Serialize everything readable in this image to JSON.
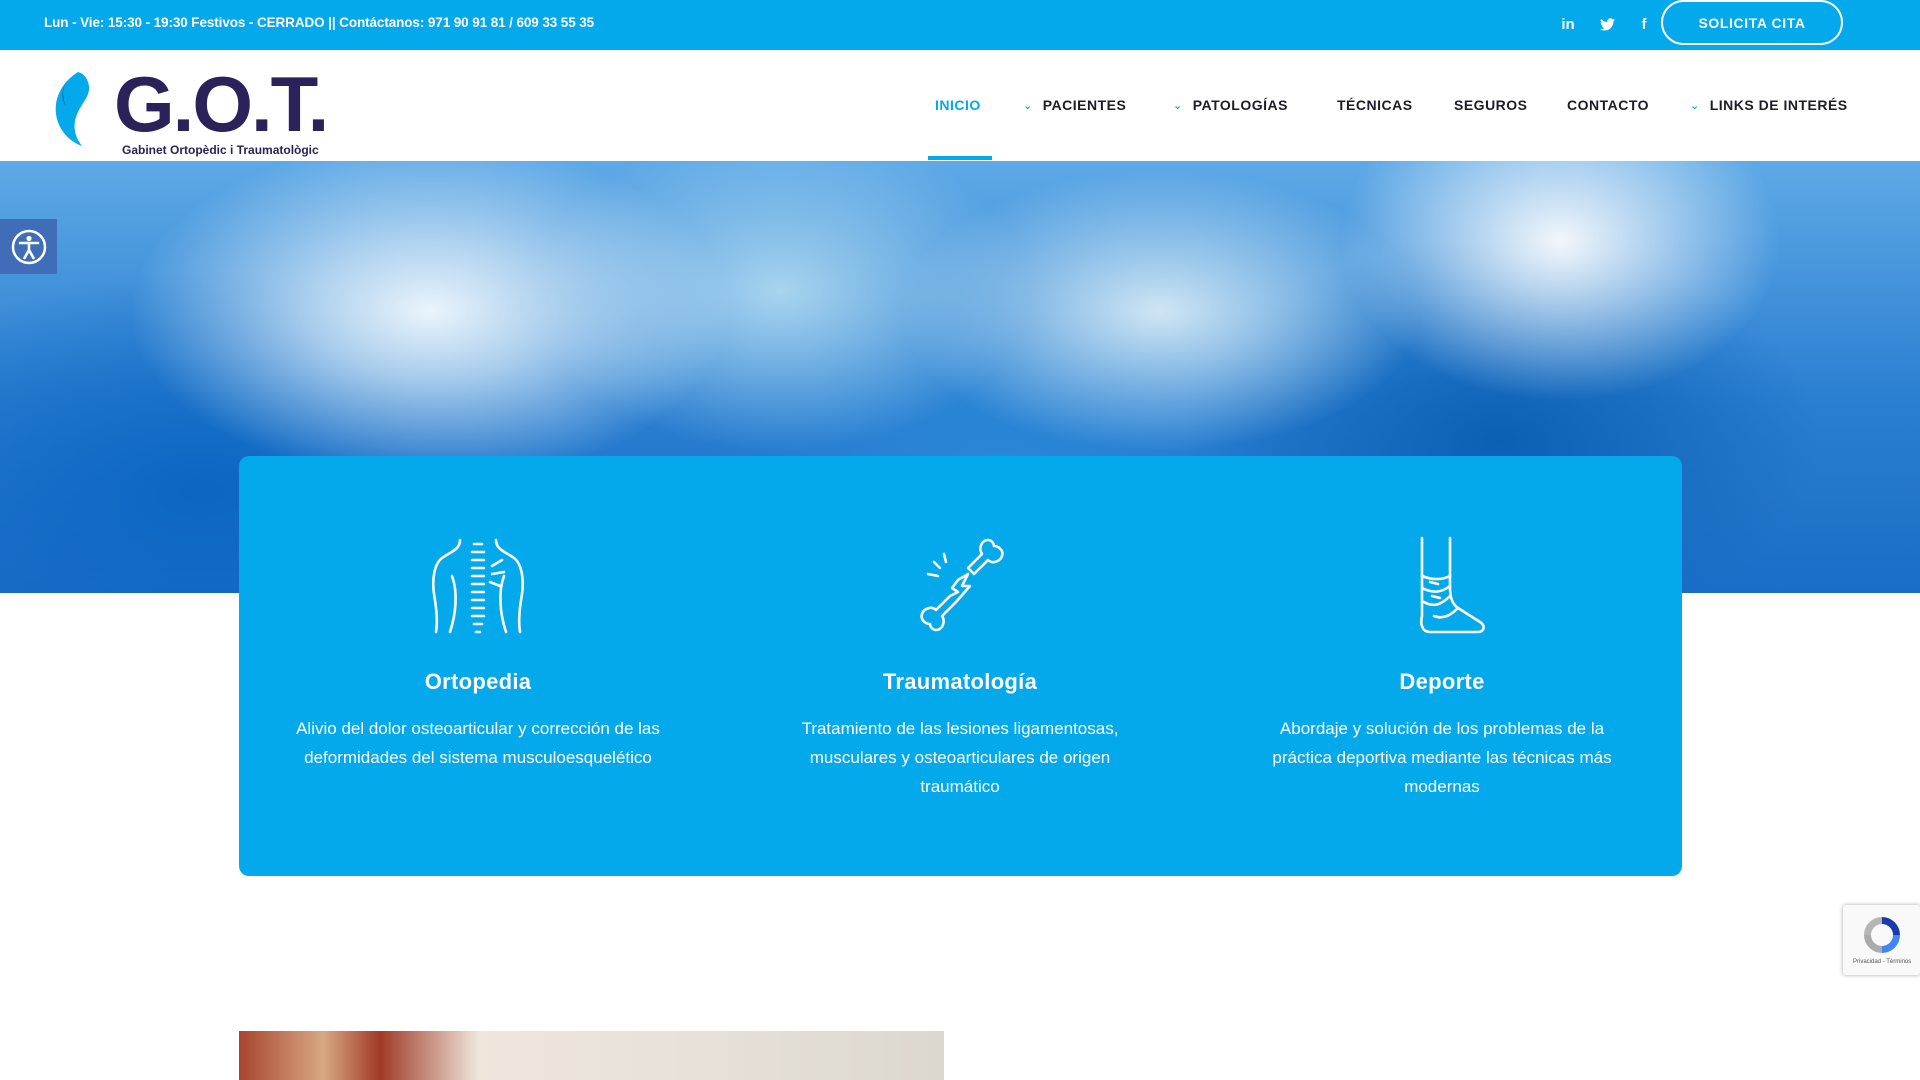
{
  "topbar": {
    "info": "Lun - Vie: 15:30 - 19:30 Festivos - CERRADO || Contáctanos: 971 90 91 81 / 609 33 55 35",
    "social": [
      {
        "icon": "linkedin-icon",
        "glyph": "in"
      },
      {
        "icon": "twitter-icon",
        "glyph": "t"
      },
      {
        "icon": "facebook-icon",
        "glyph": "f"
      }
    ],
    "cta_label": "SOLICITA CITA"
  },
  "logo": {
    "title": "G.O.T.",
    "subtitle": "Gabinet Ortopèdic i Traumatològic"
  },
  "nav": {
    "items": [
      {
        "label": "INICIO",
        "active": true,
        "dropdown": false
      },
      {
        "label": "PACIENTES",
        "active": false,
        "dropdown": true
      },
      {
        "label": "PATOLOGÍAS",
        "active": false,
        "dropdown": true
      },
      {
        "label": "TÉCNICAS",
        "active": false,
        "dropdown": false
      },
      {
        "label": "SEGUROS",
        "active": false,
        "dropdown": false
      },
      {
        "label": "CONTACTO",
        "active": false,
        "dropdown": false
      },
      {
        "label": "LINKS DE INTERÉS",
        "active": false,
        "dropdown": true
      }
    ]
  },
  "features": [
    {
      "icon": "spine-icon",
      "title": "Ortopedia",
      "text": "Alivio del dolor osteoarticular y corrección de las deformidades del sistema musculoesquelético"
    },
    {
      "icon": "broken-bone-icon",
      "title": "Traumatología",
      "text": "Tratamiento de las lesiones ligamentosas, musculares y osteoarticulares de origen traumático"
    },
    {
      "icon": "bandaged-foot-icon",
      "title": "Deporte",
      "text": "Abordaje y solución de los problemas de la práctica deportiva mediante las técnicas más modernas"
    }
  ],
  "recaptcha": {
    "text": "Privacidad - Términos"
  },
  "colors": {
    "accent": "#03a9ea",
    "brand_dark": "#2a2258",
    "accessibility": "#3f6db8"
  }
}
